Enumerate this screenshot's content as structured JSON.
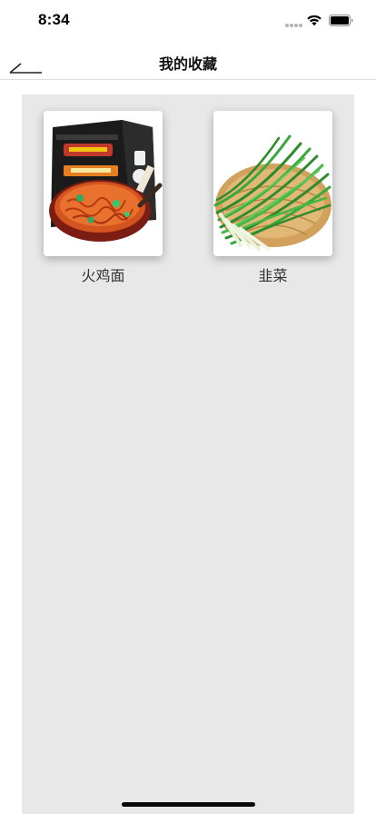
{
  "status_bar": {
    "time": "8:34"
  },
  "nav": {
    "title": "我的收藏",
    "back_icon": "back-arrow-icon"
  },
  "favorites": [
    {
      "label": "火鸡面",
      "image": "spicy-noodle-package-image"
    },
    {
      "label": "韭菜",
      "image": "chives-basket-image"
    }
  ],
  "colors": {
    "content_bg": "#e8e8e8",
    "nav_divider": "#dcdcdc",
    "text": "#333333"
  }
}
